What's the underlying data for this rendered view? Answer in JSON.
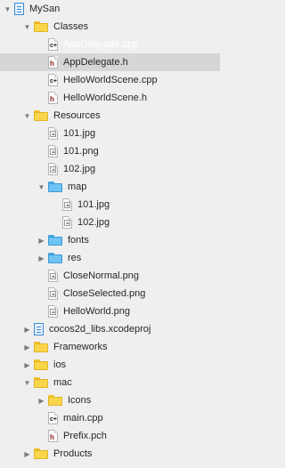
{
  "navigator": {
    "items": [
      {
        "label": "MySan",
        "icon": "xcode-project-icon",
        "level": 0,
        "expanded": true
      },
      {
        "label": "Classes",
        "icon": "yellow-folder-icon",
        "level": 1,
        "expanded": true
      },
      {
        "label": "AppDelegate.cpp",
        "icon": "cpp-file-icon",
        "level": 2,
        "state": "highlighted"
      },
      {
        "label": "AppDelegate.h",
        "icon": "header-file-icon",
        "level": 2,
        "state": "selected"
      },
      {
        "label": "HelloWorldScene.cpp",
        "icon": "cpp-file-icon",
        "level": 2
      },
      {
        "label": "HelloWorldScene.h",
        "icon": "header-file-icon",
        "level": 2
      },
      {
        "label": "Resources",
        "icon": "yellow-folder-icon",
        "level": 1,
        "expanded": true
      },
      {
        "label": "101.jpg",
        "icon": "image-file-icon",
        "level": 2
      },
      {
        "label": "101.png",
        "icon": "image-file-icon",
        "level": 2
      },
      {
        "label": "102.jpg",
        "icon": "image-file-icon",
        "level": 2
      },
      {
        "label": "map",
        "icon": "blue-folder-icon",
        "level": 2,
        "expanded": true
      },
      {
        "label": "101.jpg",
        "icon": "image-file-icon",
        "level": 3
      },
      {
        "label": "102.jpg",
        "icon": "image-file-icon",
        "level": 3
      },
      {
        "label": "fonts",
        "icon": "blue-folder-icon",
        "level": 2,
        "expanded": false
      },
      {
        "label": "res",
        "icon": "blue-folder-icon",
        "level": 2,
        "expanded": false
      },
      {
        "label": "CloseNormal.png",
        "icon": "image-file-icon",
        "level": 2
      },
      {
        "label": "CloseSelected.png",
        "icon": "image-file-icon",
        "level": 2
      },
      {
        "label": "HelloWorld.png",
        "icon": "image-file-icon",
        "level": 2
      },
      {
        "label": "cocos2d_libs.xcodeproj",
        "icon": "xcode-project-icon",
        "level": 1,
        "expanded": false
      },
      {
        "label": "Frameworks",
        "icon": "yellow-folder-icon",
        "level": 1,
        "expanded": false
      },
      {
        "label": "ios",
        "icon": "yellow-folder-icon",
        "level": 1,
        "expanded": false
      },
      {
        "label": "mac",
        "icon": "yellow-folder-icon",
        "level": 1,
        "expanded": true
      },
      {
        "label": "Icons",
        "icon": "yellow-folder-icon",
        "level": 2,
        "expanded": false
      },
      {
        "label": "main.cpp",
        "icon": "cpp-file-icon",
        "level": 2
      },
      {
        "label": "Prefix.pch",
        "icon": "header-file-icon",
        "level": 2
      },
      {
        "label": "Products",
        "icon": "yellow-folder-icon",
        "level": 1,
        "expanded": false
      }
    ]
  },
  "colors": {
    "background": "#efeff0",
    "selection": "#d6d6d8",
    "folder_yellow": "#f9d54c",
    "folder_blue": "#6ec3f2",
    "header_h": "#8a1b1b"
  }
}
